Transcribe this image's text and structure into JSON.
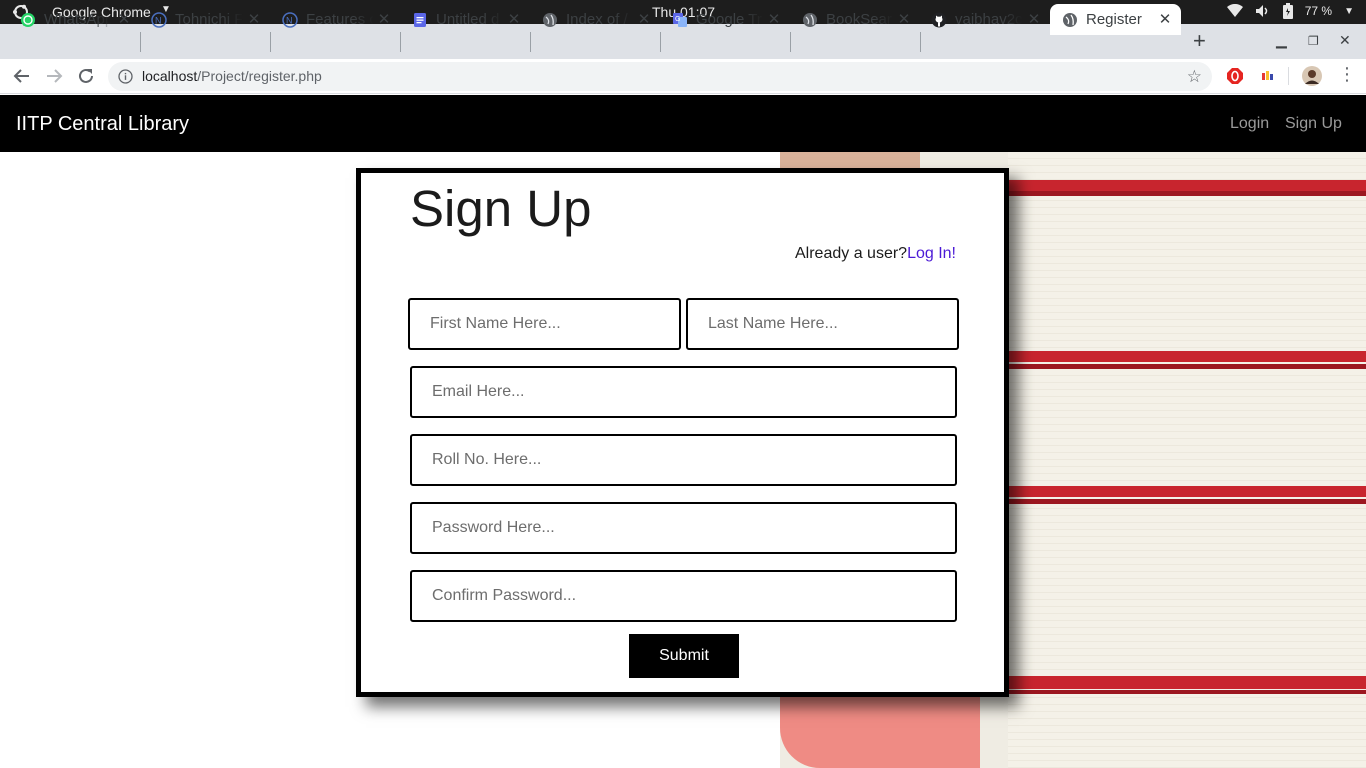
{
  "system": {
    "app_name": "Google Chrome",
    "clock": "Thu 01:07",
    "battery": "77 %"
  },
  "tabs": [
    {
      "label": "WhatsApp",
      "icon": "whatsapp-icon"
    },
    {
      "label": "Tohnichi F",
      "icon": "tohnichi-icon"
    },
    {
      "label": "Features c",
      "icon": "tohnichi-icon"
    },
    {
      "label": "Untitled d",
      "icon": "docs-icon"
    },
    {
      "label": "Index of /",
      "icon": "globe-icon"
    },
    {
      "label": "Google Tr",
      "icon": "translate-icon"
    },
    {
      "label": "BookSear",
      "icon": "globe-icon"
    },
    {
      "label": "vaibhav2c",
      "icon": "github-icon"
    },
    {
      "label": "Register",
      "icon": "globe-icon"
    }
  ],
  "address": {
    "host": "localhost",
    "path": "/Project/register.php"
  },
  "site": {
    "brand": "IITP Central Library",
    "nav": {
      "login": "Login",
      "signup": "Sign Up"
    }
  },
  "form": {
    "title": "Sign Up",
    "already_text": "Already a user?",
    "login_link": "Log In!",
    "first_name_placeholder": "First Name Here...",
    "last_name_placeholder": "Last Name Here...",
    "email_placeholder": "Email Here...",
    "roll_placeholder": "Roll No. Here...",
    "password_placeholder": "Password Here...",
    "confirm_placeholder": "Confirm Password...",
    "submit_label": "Submit"
  },
  "colors": {
    "link": "#4b1ad6",
    "navbar_bg": "#000000",
    "book_stripe": "#c8252e"
  }
}
